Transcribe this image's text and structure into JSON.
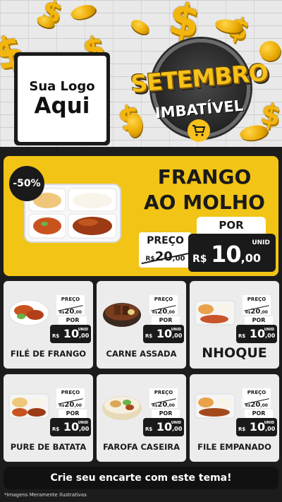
{
  "logo": {
    "line1": "Sua Logo",
    "line2": "Aqui"
  },
  "badge": {
    "title": "SETEMBRO",
    "subtitle": "IMBATÍVEL",
    "icon": "shopping-cart-icon"
  },
  "hero": {
    "discount": "-50%",
    "title_line1": "FRANGO",
    "title_line2": "AO MOLHO",
    "preco_label": "PREÇO",
    "old_price": {
      "currency": "R$",
      "integer": "20",
      "decimal": ",00"
    },
    "por_label": "POR",
    "unid_label": "UNID",
    "new_price": {
      "currency": "R$",
      "integer": "10",
      "decimal": ",00"
    }
  },
  "products": [
    {
      "name": "FILÉ DE FRANGO",
      "preco_label": "PREÇO",
      "old_currency": "R$",
      "old_integer": "20",
      "old_decimal": ",00",
      "por_label": "POR",
      "unid_label": "UNID",
      "currency": "R$",
      "integer": "10",
      "decimal": ",00"
    },
    {
      "name": "CARNE ASSADA",
      "preco_label": "PREÇO",
      "old_currency": "R$",
      "old_integer": "20",
      "old_decimal": ",00",
      "por_label": "POR",
      "unid_label": "UNID",
      "currency": "R$",
      "integer": "10",
      "decimal": ",00"
    },
    {
      "name": "NHOQUE",
      "preco_label": "PREÇO",
      "old_currency": "R$",
      "old_integer": "20",
      "old_decimal": ",00",
      "por_label": "POR",
      "unid_label": "UNID",
      "currency": "R$",
      "integer": "10",
      "decimal": ",00"
    },
    {
      "name": "PURE DE BATATA",
      "preco_label": "PREÇO",
      "old_currency": "R$",
      "old_integer": "20",
      "old_decimal": ",00",
      "por_label": "POR",
      "unid_label": "UNID",
      "currency": "R$",
      "integer": "10",
      "decimal": ",00"
    },
    {
      "name": "FAROFA CASEIRA",
      "preco_label": "PREÇO",
      "old_currency": "R$",
      "old_integer": "20",
      "old_decimal": ",00",
      "por_label": "POR",
      "unid_label": "UNID",
      "currency": "R$",
      "integer": "10",
      "decimal": ",00"
    },
    {
      "name": "FILE EMPANADO",
      "preco_label": "PREÇO",
      "old_currency": "R$",
      "old_integer": "20",
      "old_decimal": ",00",
      "por_label": "POR",
      "unid_label": "UNID",
      "currency": "R$",
      "integer": "10",
      "decimal": ",00"
    }
  ],
  "cta": "Crie seu encarte com este tema!",
  "disclaimer": "*Imagens Meramente Ilustrativas",
  "colors": {
    "accent": "#f1c416",
    "dark": "#1a1a1a",
    "card": "#ececec"
  }
}
